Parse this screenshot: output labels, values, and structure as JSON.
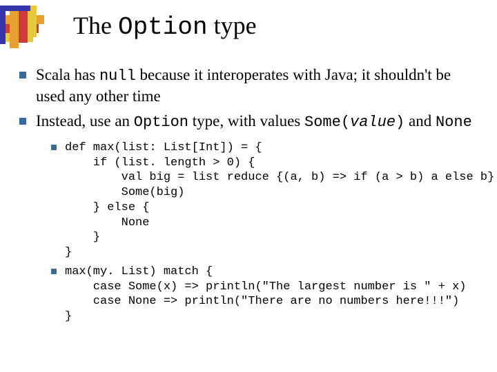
{
  "title": {
    "prefix": "The ",
    "mono": "Option",
    "suffix": " type"
  },
  "bullets": [
    {
      "segments": [
        {
          "t": "Scala has "
        },
        {
          "t": "null",
          "mono": true
        },
        {
          "t": " because it interoperates with Java; it shouldn't be used any other time"
        }
      ]
    },
    {
      "segments": [
        {
          "t": "Instead, use an "
        },
        {
          "t": "Option",
          "mono": true
        },
        {
          "t": " type, with values "
        },
        {
          "t": "Some(",
          "mono": true
        },
        {
          "t": "value",
          "mono": true,
          "italic": true
        },
        {
          "t": ")",
          "mono": true
        },
        {
          "t": " and "
        },
        {
          "t": "None",
          "mono": true
        }
      ]
    }
  ],
  "code_blocks": [
    "def max(list: List[Int]) = {\n    if (list. length > 0) {\n        val big = list reduce {(a, b) => if (a > b) a else b}\n        Some(big)\n    } else {\n        None\n    }\n}",
    "max(my. List) match {\n    case Some(x) => println(\"The largest number is \" + x)\n    case None => println(\"There are no numbers here!!!\")\n}"
  ],
  "deco": {
    "h_colors": [
      "#e8a030",
      "#d03a3a",
      "#e8c840"
    ],
    "v_colors": [
      "#e8a030",
      "#d03a3a",
      "#e8c840"
    ]
  }
}
